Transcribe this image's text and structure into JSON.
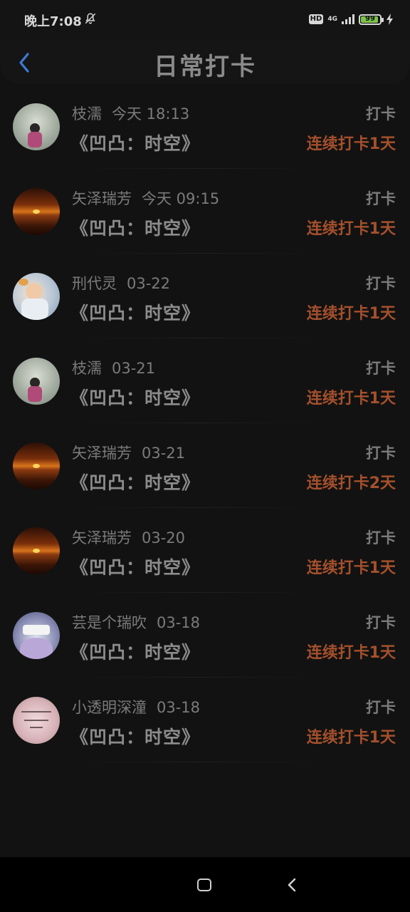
{
  "status_bar": {
    "time": "晚上7:08",
    "hd": "HD",
    "network": "4G",
    "battery": "99"
  },
  "header": {
    "title": "日常打卡"
  },
  "items": [
    {
      "user": "枝濡",
      "date": "今天 18:13",
      "book": "《凹凸：时空》",
      "action": "打卡",
      "streak": "连续打卡1天",
      "avatar": "girl-avatar"
    },
    {
      "user": "矢泽瑞芳",
      "date": "今天 09:15",
      "book": "《凹凸：时空》",
      "action": "打卡",
      "streak": "连续打卡1天",
      "avatar": "sunset-avatar"
    },
    {
      "user": "刑代灵",
      "date": "03-22",
      "book": "《凹凸：时空》",
      "action": "打卡",
      "streak": "连续打卡1天",
      "avatar": "kid-avatar"
    },
    {
      "user": "枝濡",
      "date": "03-21",
      "book": "《凹凸：时空》",
      "action": "打卡",
      "streak": "连续打卡1天",
      "avatar": "girl-avatar"
    },
    {
      "user": "矢泽瑞芳",
      "date": "03-21",
      "book": "《凹凸：时空》",
      "action": "打卡",
      "streak": "连续打卡2天",
      "avatar": "sunset-avatar"
    },
    {
      "user": "矢泽瑞芳",
      "date": "03-20",
      "book": "《凹凸：时空》",
      "action": "打卡",
      "streak": "连续打卡1天",
      "avatar": "sunset-avatar"
    },
    {
      "user": "芸是个瑞吹",
      "date": "03-18",
      "book": "《凹凸：时空》",
      "action": "打卡",
      "streak": "连续打卡1天",
      "avatar": "anime-avatar"
    },
    {
      "user": "小透明深潼",
      "date": "03-18",
      "book": "《凹凸：时空》",
      "action": "打卡",
      "streak": "连续打卡1天",
      "avatar": "text-avatar"
    }
  ],
  "colors": {
    "background": "#121212",
    "accent": "#a4502c",
    "back_arrow": "#3d7bd4"
  }
}
